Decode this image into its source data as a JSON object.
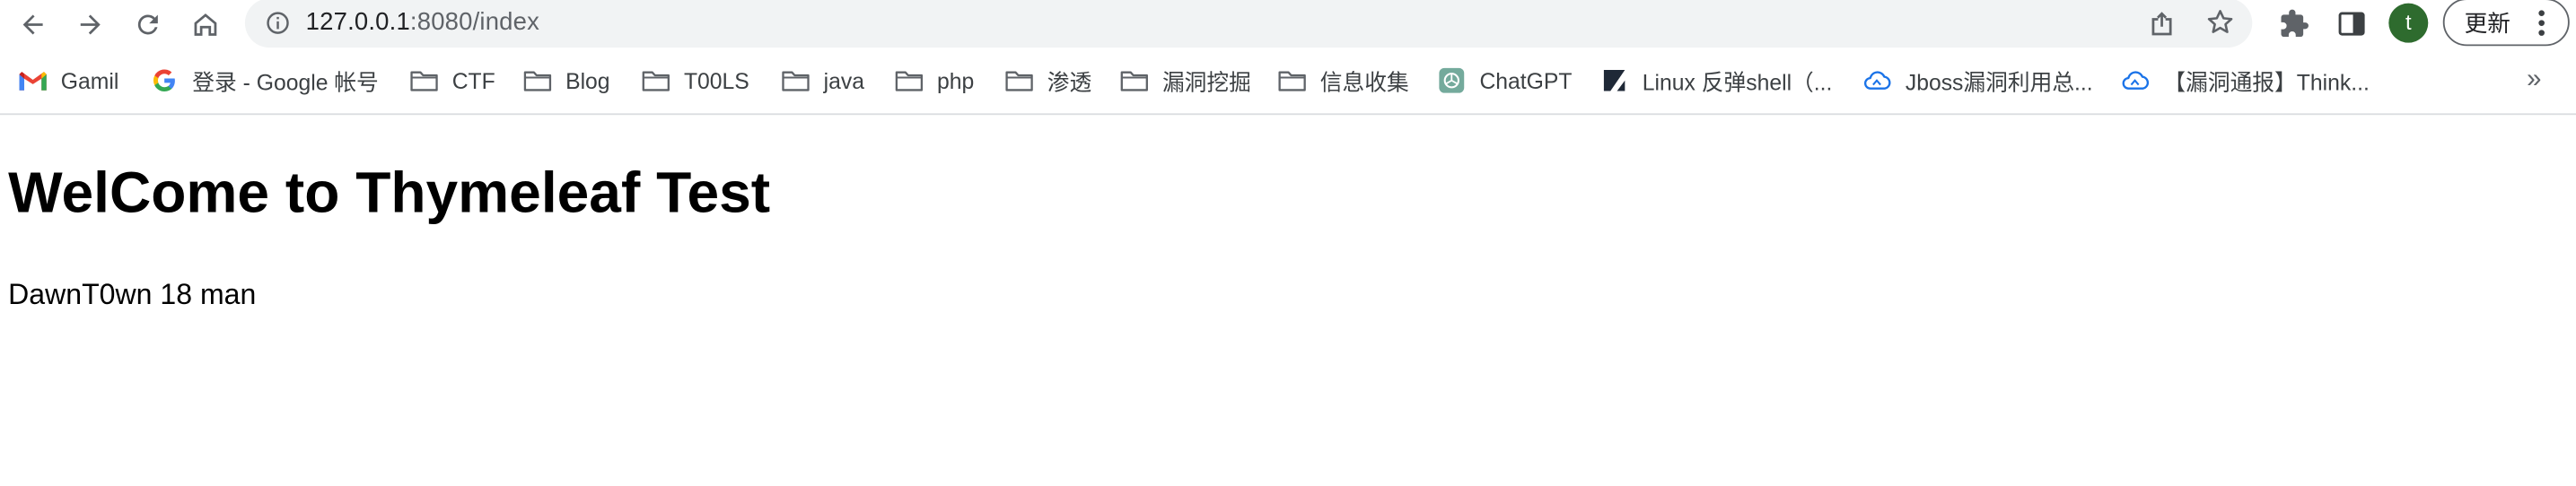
{
  "browser": {
    "url_host": "127.0.0.1",
    "url_rest": ":8080/index",
    "profile_initial": "t",
    "profile_color": "#2e6b2e",
    "update_label": "更新"
  },
  "bookmarks": [
    {
      "label": "Gamil",
      "icon": "gmail-icon"
    },
    {
      "label": "登录 - Google 帐号",
      "icon": "google-icon"
    },
    {
      "label": "CTF",
      "icon": "folder-icon"
    },
    {
      "label": "Blog",
      "icon": "folder-icon"
    },
    {
      "label": "T00LS",
      "icon": "folder-icon"
    },
    {
      "label": "java",
      "icon": "folder-icon"
    },
    {
      "label": "php",
      "icon": "folder-icon"
    },
    {
      "label": "渗透",
      "icon": "folder-icon"
    },
    {
      "label": "漏洞挖掘",
      "icon": "folder-icon"
    },
    {
      "label": "信息收集",
      "icon": "folder-icon"
    },
    {
      "label": "ChatGPT",
      "icon": "chatgpt-icon"
    },
    {
      "label": "Linux 反弹shell（...",
      "icon": "shell-icon"
    },
    {
      "label": "Jboss漏洞利用总...",
      "icon": "cloud-icon"
    },
    {
      "label": "【漏洞通报】Think...",
      "icon": "cloud-icon"
    }
  ],
  "bookmarks_more": "»",
  "page": {
    "title": "WelCome to Thymeleaf Test",
    "text": "DawnT0wn 18 man"
  }
}
